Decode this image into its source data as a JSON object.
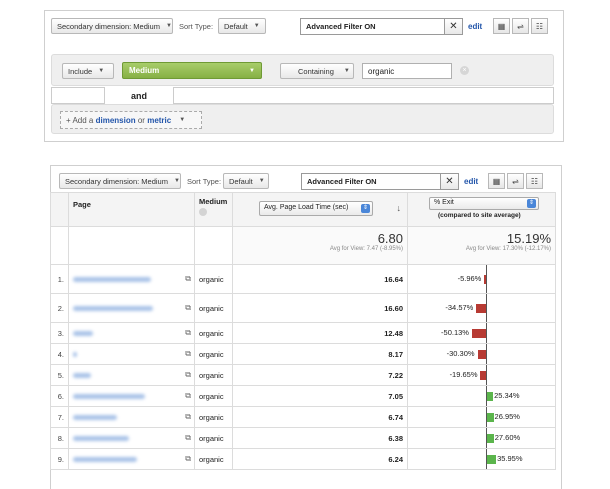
{
  "top": {
    "secondary_dimension": "Secondary dimension: Medium",
    "sort_type_label": "Sort Type:",
    "sort_type_value": "Default",
    "filter_value": "Advanced Filter ON",
    "edit": "edit",
    "include": "Include",
    "dimension": "Medium",
    "match": "Containing",
    "filter_text": "organic",
    "and": "and",
    "add_prefix": "+ Add a",
    "add_dimension": "dimension",
    "add_or": "or",
    "add_metric": "metric"
  },
  "bottom": {
    "secondary_dimension": "Secondary dimension: Medium",
    "sort_type_label": "Sort Type:",
    "sort_type_value": "Default",
    "filter_value": "Advanced Filter ON",
    "edit": "edit",
    "col_page": "Page",
    "col_medium": "Medium",
    "metric_select": "Avg. Page Load Time (sec)",
    "compare_select": "% Exit",
    "compare_note": "(compared to site average)",
    "total_value": "6.80",
    "total_note": "Avg for View: 7.47 (-8.95%)",
    "compare_total": "15.19%",
    "compare_total_note": "Avg for View: 17.30% (-12.17%)"
  },
  "rows": [
    {
      "index": "1.",
      "medium": "organic",
      "value": "16.64",
      "pct": "-5.96%",
      "delta": -5.96
    },
    {
      "index": "2.",
      "medium": "organic",
      "value": "16.60",
      "pct": "-34.57%",
      "delta": -34.57
    },
    {
      "index": "3.",
      "medium": "organic",
      "value": "12.48",
      "pct": "-50.13%",
      "delta": -50.13
    },
    {
      "index": "4.",
      "medium": "organic",
      "value": "8.17",
      "pct": "-30.30%",
      "delta": -30.3
    },
    {
      "index": "5.",
      "medium": "organic",
      "value": "7.22",
      "pct": "-19.65%",
      "delta": -19.65
    },
    {
      "index": "6.",
      "medium": "organic",
      "value": "7.05",
      "pct": "25.34%",
      "delta": 25.34
    },
    {
      "index": "7.",
      "medium": "organic",
      "value": "6.74",
      "pct": "26.95%",
      "delta": 26.95
    },
    {
      "index": "8.",
      "medium": "organic",
      "value": "6.38",
      "pct": "27.60%",
      "delta": 27.6
    },
    {
      "index": "9.",
      "medium": "organic",
      "value": "6.24",
      "pct": "35.95%",
      "delta": 35.95
    }
  ],
  "colors": {
    "negative": "#b73a33",
    "positive": "#5bb54c",
    "accent": "#2255aa"
  }
}
